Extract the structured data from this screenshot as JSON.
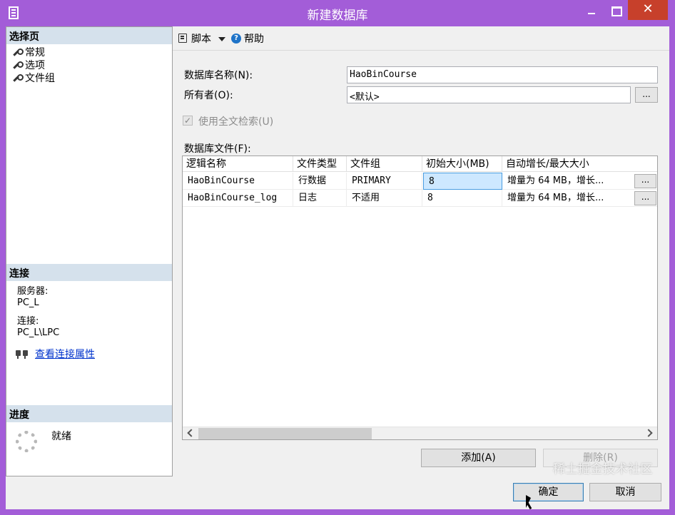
{
  "window": {
    "title": "新建数据库",
    "close_glyph": "✕"
  },
  "left": {
    "select_page_header": "选择页",
    "pages": [
      {
        "label": "常规",
        "icon": "wrench-icon"
      },
      {
        "label": "选项",
        "icon": "wrench-icon"
      },
      {
        "label": "文件组",
        "icon": "wrench-icon"
      }
    ],
    "connection_header": "连接",
    "server_label": "服务器:",
    "server_value": "PC_L",
    "connection_label": "连接:",
    "connection_value": "PC_L\\LPC",
    "view_props_link": "查看连接属性",
    "progress_header": "进度",
    "progress_status": "就绪"
  },
  "toolbar": {
    "script_label": "脚本",
    "help_label": "帮助"
  },
  "form": {
    "db_name_label": "数据库名称(N):",
    "db_name_value": "HaoBinCourse",
    "owner_label": "所有者(O):",
    "owner_value": "<默认>",
    "browse_label": "...",
    "fulltext_label": "使用全文检索(U)",
    "fulltext_checked": true,
    "files_label": "数据库文件(F):"
  },
  "grid": {
    "columns": [
      "逻辑名称",
      "文件类型",
      "文件组",
      "初始大小(MB)",
      "自动增长/最大大小"
    ],
    "rows": [
      {
        "name": "HaoBinCourse",
        "type": "行数据",
        "group": "PRIMARY",
        "size": "8",
        "growth": "增量为 64 MB，增长...",
        "btn": "..."
      },
      {
        "name": "HaoBinCourse_log",
        "type": "日志",
        "group": "不适用",
        "size": "8",
        "growth": "增量为 64 MB，增长...",
        "btn": "..."
      }
    ]
  },
  "buttons": {
    "add": "添加(A)",
    "remove": "删除(R)",
    "ok": "确定",
    "cancel": "取消"
  },
  "watermark": "稀土掘金技术社区"
}
